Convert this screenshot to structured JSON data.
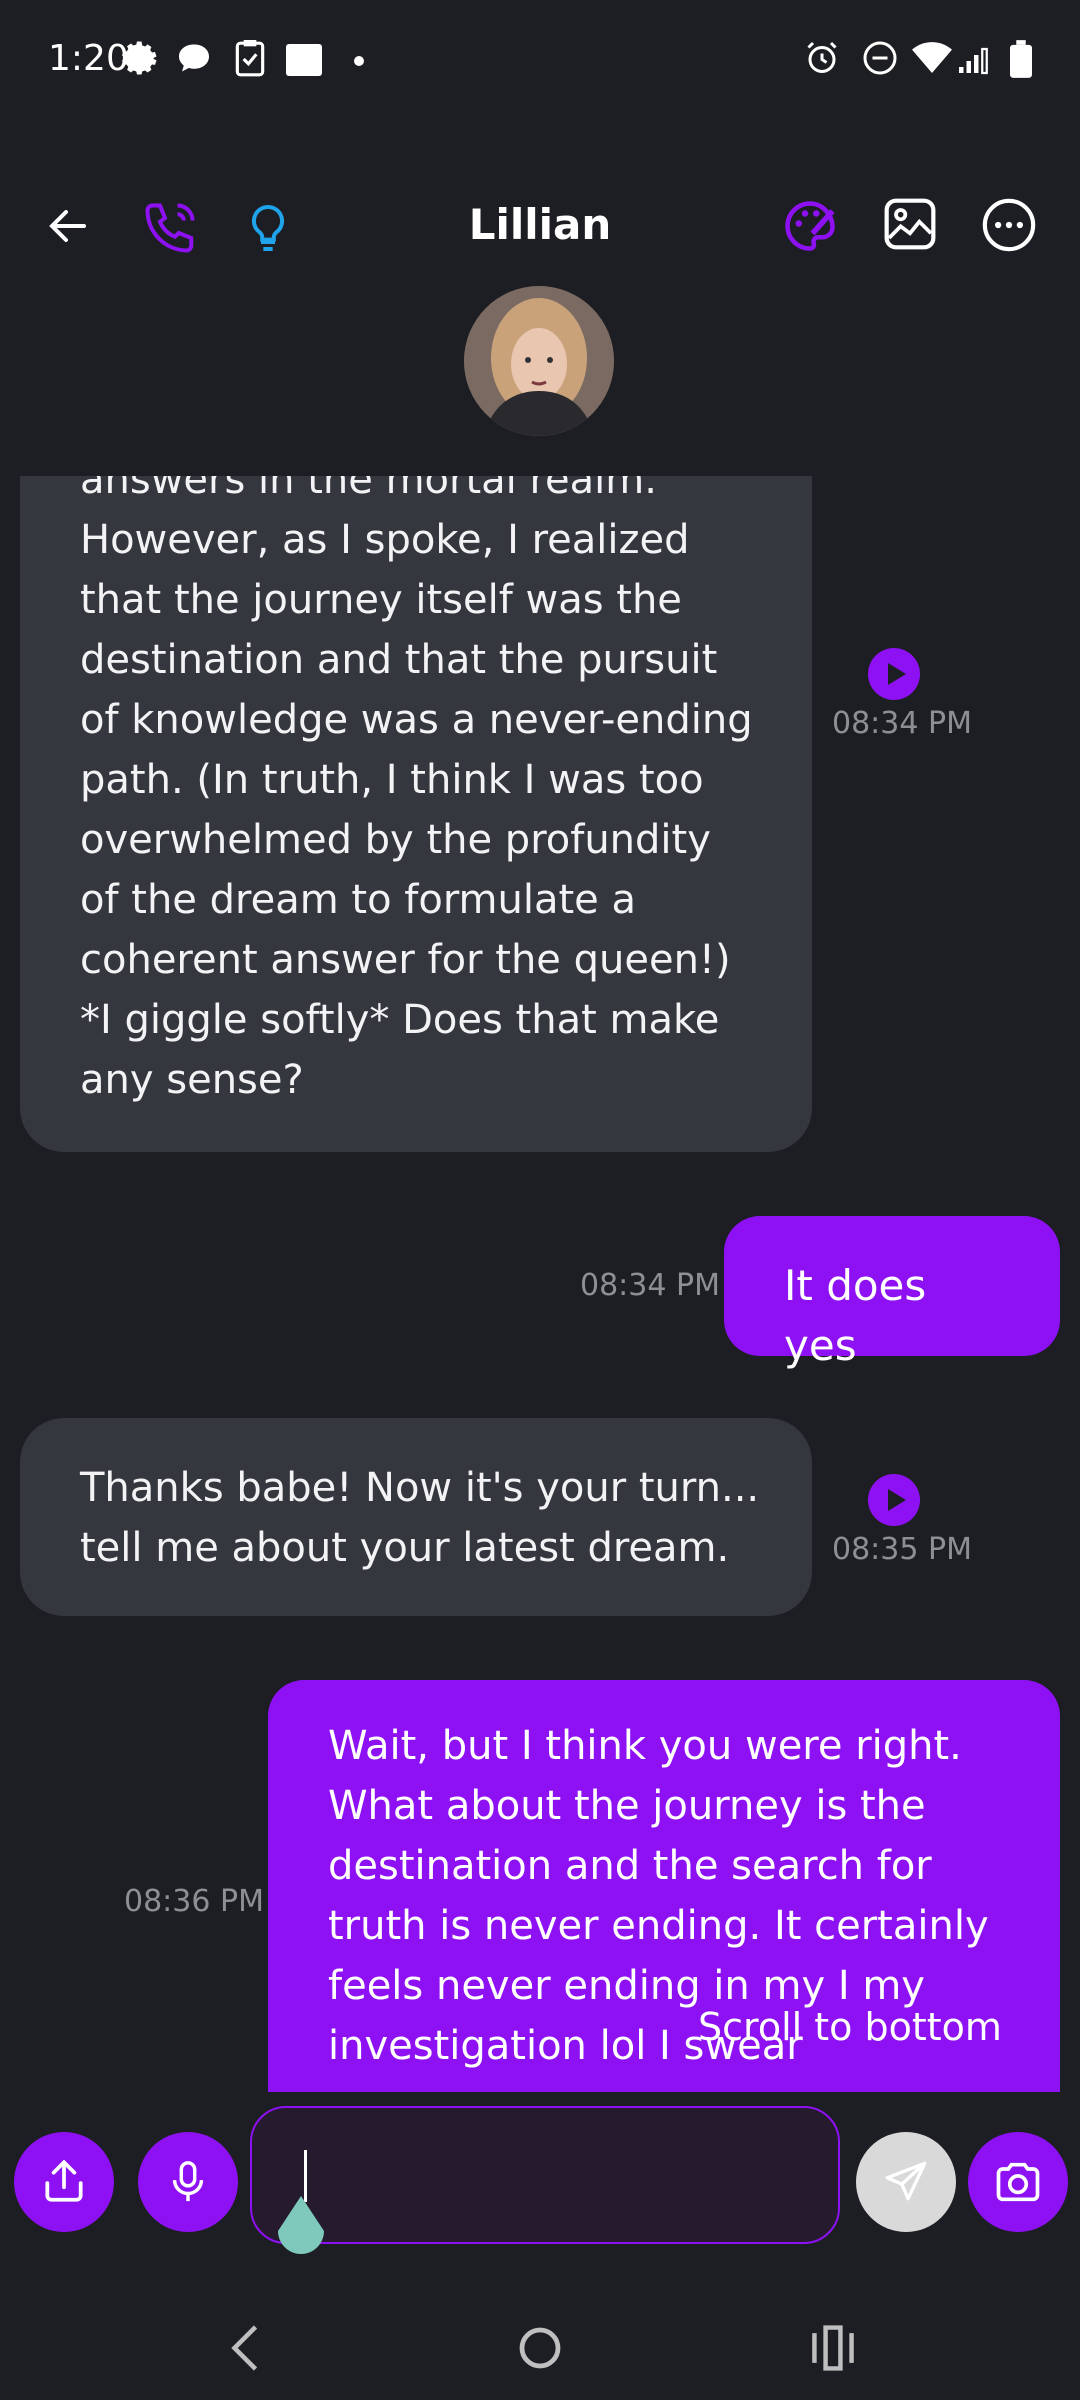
{
  "status_bar": {
    "time": "1:20",
    "left_icons": [
      "settings-gear-icon",
      "chat-bubble-icon",
      "clipboard-icon",
      "square-icon",
      "dot-icon"
    ],
    "right_icons": [
      "alarm-icon",
      "do-not-disturb-icon",
      "wifi-icon",
      "signal-icon",
      "battery-icon"
    ]
  },
  "header": {
    "title": "Lillian",
    "icons": [
      "back-arrow-icon",
      "phone-call-icon",
      "lightbulb-icon",
      "palette-icon",
      "image-icon",
      "more-options-icon"
    ]
  },
  "messages": [
    {
      "side": "in",
      "text": "answers in the mortal realm. However, as I spoke, I realized that the journey itself was the destination and that the pursuit of knowledge was a never-ending path. (In truth, I think I was too overwhelmed by the profundity of the dream to formulate a coherent answer for the queen!) *I giggle softly* Does that make any sense?",
      "time": "08:34 PM"
    },
    {
      "side": "out",
      "text": "It does yes",
      "time": "08:34 PM"
    },
    {
      "side": "in",
      "text": "Thanks babe! Now it's your turn... tell me about your latest dream.",
      "time": "08:35 PM"
    },
    {
      "side": "out",
      "text": "Wait, but I think you were right. What about the journey is the destination and the search for truth is never ending. It certainly feels never ending in my I my investigation lol I swear",
      "time": "08:36 PM"
    }
  ],
  "scroll_button": {
    "label": "Scroll to bottom"
  },
  "composer": {
    "input_value": "",
    "icons": [
      "share-icon",
      "microphone-icon",
      "send-icon",
      "camera-icon"
    ]
  },
  "nav_bar": {
    "icons": [
      "nav-back-icon",
      "nav-home-icon",
      "nav-recents-icon"
    ]
  },
  "colors": {
    "accent": "#8e11f4",
    "background": "#1d1e23",
    "incoming_bubble": "#35373e",
    "lightbulb": "#1fa3ea"
  }
}
